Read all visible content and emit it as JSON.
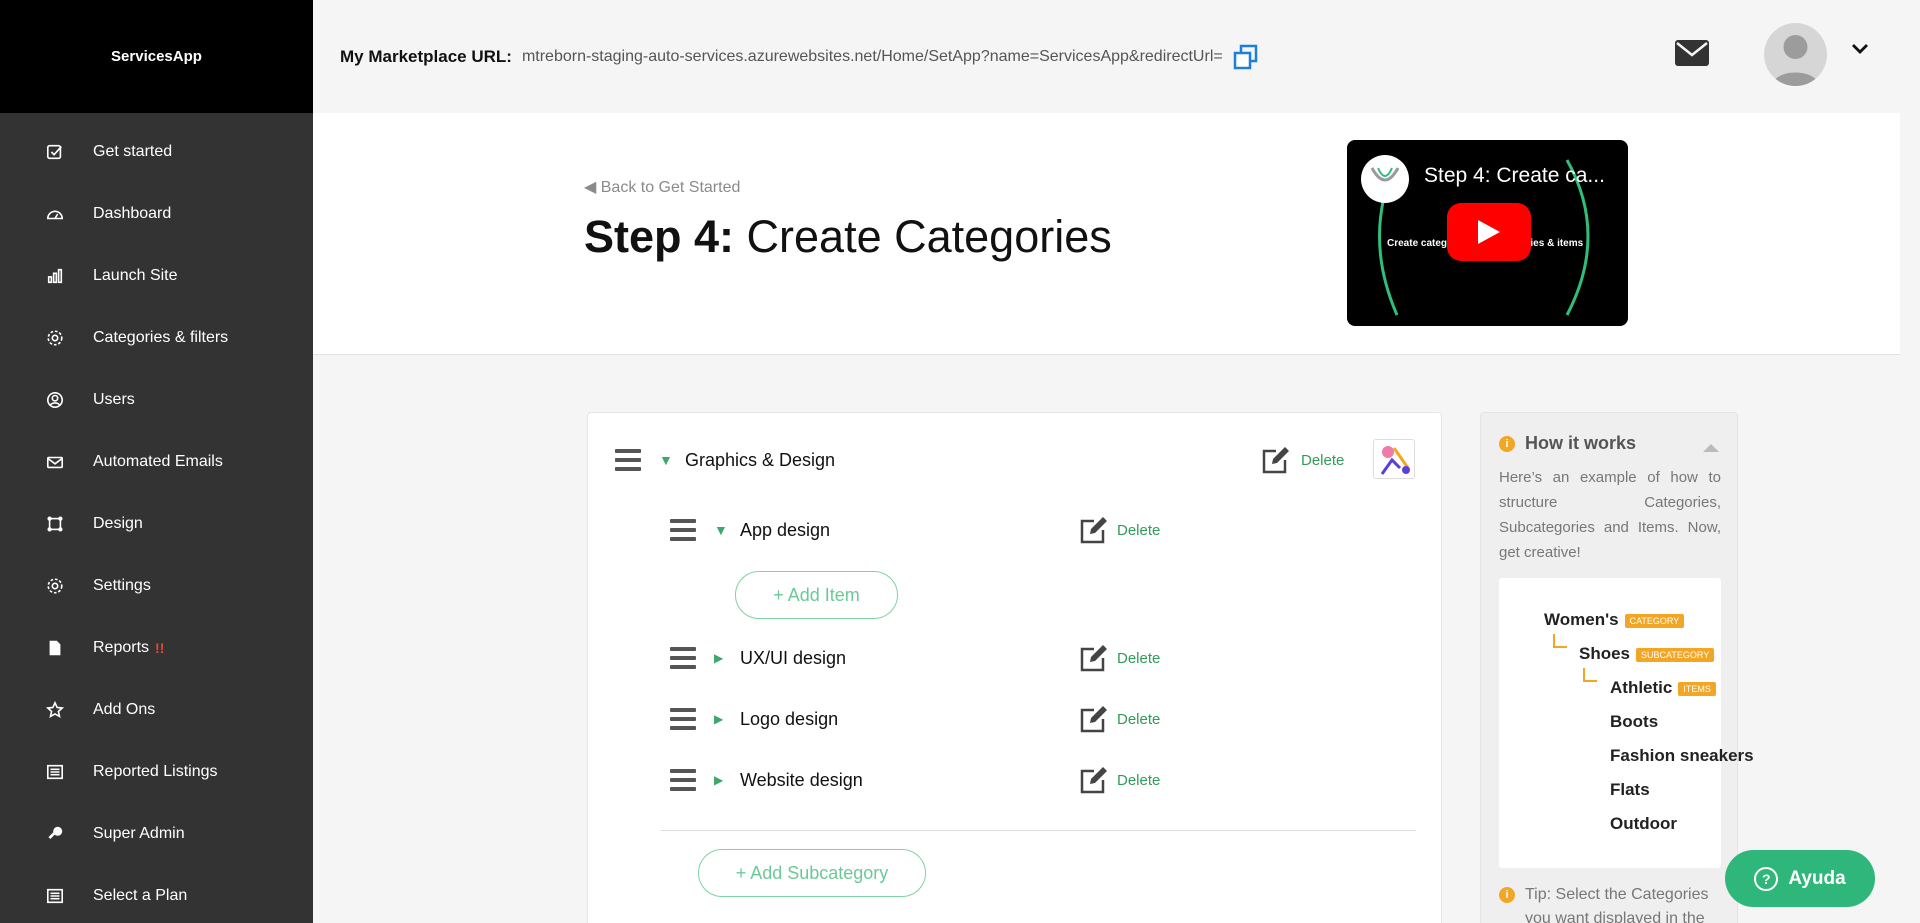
{
  "brand": "ServicesApp",
  "sidebar": {
    "items": [
      {
        "label": "Get started",
        "icon": "checkbox-icon"
      },
      {
        "label": "Dashboard",
        "icon": "gauge-icon"
      },
      {
        "label": "Launch Site",
        "icon": "bar-chart-icon"
      },
      {
        "label": "Categories & filters",
        "icon": "gear-icon"
      },
      {
        "label": "Users",
        "icon": "user-circle-icon"
      },
      {
        "label": "Automated Emails",
        "icon": "envelope-icon"
      },
      {
        "label": "Design",
        "icon": "crop-icon"
      },
      {
        "label": "Settings",
        "icon": "gear-icon"
      },
      {
        "label": "Reports",
        "icon": "file-icon",
        "alert": "!!"
      },
      {
        "label": "Add Ons",
        "icon": "star-icon"
      },
      {
        "label": "Reported Listings",
        "icon": "list-icon"
      },
      {
        "label": "Super Admin",
        "icon": "key-icon"
      },
      {
        "label": "Select a Plan",
        "icon": "list-icon"
      }
    ]
  },
  "topbar": {
    "marketplace_label": "My Marketplace URL:",
    "marketplace_url": "mtreborn-staging-auto-services.azurewebsites.net/Home/SetApp?name=ServicesApp&redirectUrl="
  },
  "header": {
    "back_link": "◀ Back to Get Started",
    "title_bold": "Step 4:",
    "title_rest": "Create Categories",
    "video_title": "Step 4: Create ca...",
    "video_subtitle": "Create categories, subcategories & items"
  },
  "categories": {
    "category": {
      "name": "Graphics & Design",
      "delete_label": "Delete"
    },
    "subcategories": [
      {
        "name": "App design",
        "delete_label": "Delete",
        "expanded": true
      },
      {
        "name": "UX/UI design",
        "delete_label": "Delete",
        "expanded": false
      },
      {
        "name": "Logo design",
        "delete_label": "Delete",
        "expanded": false
      },
      {
        "name": "Website design",
        "delete_label": "Delete",
        "expanded": false
      }
    ],
    "add_item_label": "+ Add Item",
    "add_subcategory_label": "+ Add Subcategory"
  },
  "how_it_works": {
    "title": "How it works",
    "text": "Here’s an example of how to structure Categories, Subcategories and Items. Now, get creative!",
    "example": {
      "category": "Women's",
      "category_tag": "CATEGORY",
      "subcategory": "Shoes",
      "subcategory_tag": "SUBCATEGORY",
      "items_tag": "ITEMS",
      "items": [
        "Athletic",
        "Boots",
        "Fashion sneakers",
        "Flats",
        "Outdoor"
      ]
    },
    "tip": "Tip: Select the Categories you want displayed in the"
  },
  "help_button": "Ayuda",
  "colors": {
    "accent_green": "#2fb67a",
    "tag_orange": "#f2a623",
    "sidebar_bg": "#333333"
  }
}
